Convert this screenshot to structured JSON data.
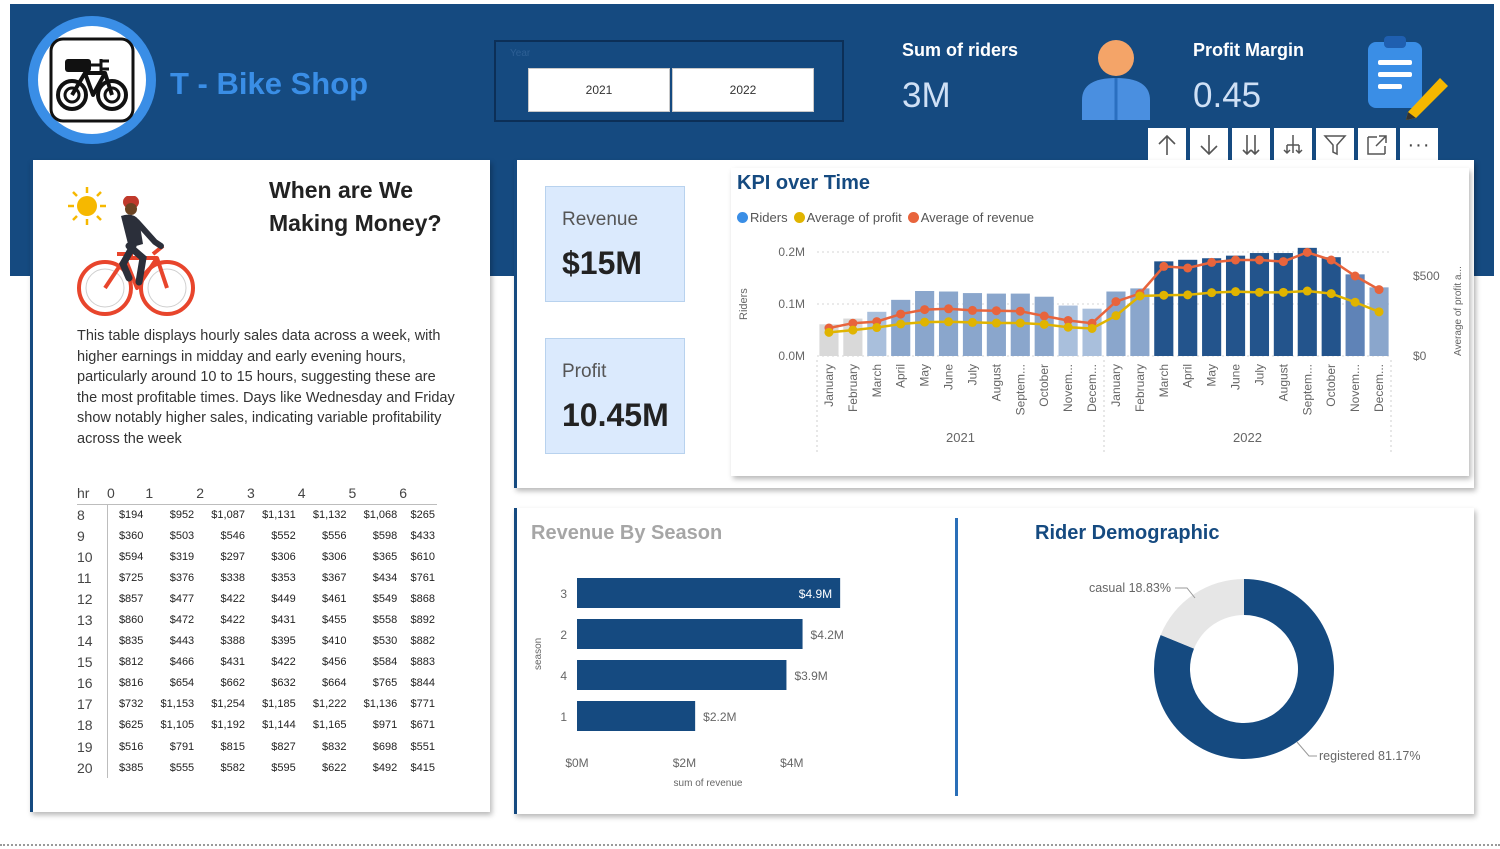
{
  "header": {
    "brand": "T - Bike Shop",
    "slicer": {
      "title": "Year",
      "options": [
        "2021",
        "2022"
      ]
    },
    "kpis": [
      {
        "title": "Sum of riders",
        "value": "3M"
      },
      {
        "title": "Profit Margin",
        "value": "0.45"
      }
    ]
  },
  "left_panel": {
    "title": "When are We Making Money?",
    "description": "This table displays hourly sales data across a week, with higher earnings in midday and early evening hours, particularly around 10 to 15 hours, suggesting these are the most profitable times. Days like Wednesday and Friday show notably higher sales, indicating variable profitability across the week",
    "table": {
      "header": [
        "hr",
        "0",
        "1",
        "2",
        "3",
        "4",
        "5",
        "6"
      ],
      "rows": [
        [
          "8",
          "$194",
          "$952",
          "$1,087",
          "$1,131",
          "$1,132",
          "$1,068",
          "$265"
        ],
        [
          "9",
          "$360",
          "$503",
          "$546",
          "$552",
          "$556",
          "$598",
          "$433"
        ],
        [
          "10",
          "$594",
          "$319",
          "$297",
          "$306",
          "$306",
          "$365",
          "$610"
        ],
        [
          "11",
          "$725",
          "$376",
          "$338",
          "$353",
          "$367",
          "$434",
          "$761"
        ],
        [
          "12",
          "$857",
          "$477",
          "$422",
          "$449",
          "$461",
          "$549",
          "$868"
        ],
        [
          "13",
          "$860",
          "$472",
          "$422",
          "$431",
          "$455",
          "$558",
          "$892"
        ],
        [
          "14",
          "$835",
          "$443",
          "$388",
          "$395",
          "$410",
          "$530",
          "$882"
        ],
        [
          "15",
          "$812",
          "$466",
          "$431",
          "$422",
          "$456",
          "$584",
          "$883"
        ],
        [
          "16",
          "$816",
          "$654",
          "$662",
          "$632",
          "$664",
          "$765",
          "$844"
        ],
        [
          "17",
          "$732",
          "$1,153",
          "$1,254",
          "$1,185",
          "$1,222",
          "$1,136",
          "$771"
        ],
        [
          "18",
          "$625",
          "$1,105",
          "$1,192",
          "$1,144",
          "$1,165",
          "$971",
          "$671"
        ],
        [
          "19",
          "$516",
          "$791",
          "$815",
          "$827",
          "$832",
          "$698",
          "$551"
        ],
        [
          "20",
          "$385",
          "$555",
          "$582",
          "$595",
          "$622",
          "$492",
          "$415"
        ]
      ]
    }
  },
  "metrics": [
    {
      "label": "Revenue",
      "value": "$15M"
    },
    {
      "label": "Profit",
      "value": "10.45M"
    }
  ],
  "toolbar": {
    "icons": [
      "arrow-up-icon",
      "arrow-down-icon",
      "double-arrow-down-icon",
      "expand-hierarchy-icon",
      "filter-icon",
      "focus-mode-icon",
      "more-options-icon"
    ],
    "more_label": "···"
  },
  "colors": {
    "header_bg": "#154a80",
    "accent": "#3a8ee6",
    "bar_dark": "#154a80",
    "profit_line": "#e0b400",
    "revenue_line": "#e8643c",
    "casual": "#e6e6e6"
  },
  "chart_data": [
    {
      "type": "bar",
      "title": "KPI over Time",
      "legend": [
        "Riders",
        "Average of profit",
        "Average of revenue"
      ],
      "legend_colors": [
        "#3a8ee6",
        "#e0b400",
        "#e8643c"
      ],
      "legend_position": "top-left",
      "ylabel": "Riders",
      "y2label": "Average of profit a...",
      "y_ticks": [
        "0.0M",
        "0.1M",
        "0.2M"
      ],
      "y2_ticks": [
        "$0",
        "$500"
      ],
      "ylim": [
        0,
        0.2
      ],
      "y2lim": [
        0,
        650
      ],
      "year_groups": [
        "2021",
        "2022"
      ],
      "categories": [
        "January",
        "February",
        "March",
        "April",
        "May",
        "June",
        "July",
        "August",
        "Septem...",
        "October",
        "Novem...",
        "Decem...",
        "January",
        "February",
        "March",
        "April",
        "May",
        "June",
        "July",
        "August",
        "Septem...",
        "October",
        "Novem...",
        "Decem..."
      ],
      "series": [
        {
          "name": "Riders",
          "type": "bar",
          "values": [
            0.061,
            0.072,
            0.085,
            0.108,
            0.125,
            0.124,
            0.121,
            0.12,
            0.12,
            0.114,
            0.097,
            0.091,
            0.124,
            0.13,
            0.182,
            0.185,
            0.188,
            0.193,
            0.198,
            0.198,
            0.208,
            0.19,
            0.157,
            0.132
          ]
        },
        {
          "name": "Average of profit",
          "type": "line",
          "values": [
            148,
            162,
            178,
            200,
            212,
            214,
            210,
            206,
            206,
            198,
            180,
            172,
            252,
            375,
            380,
            382,
            396,
            402,
            398,
            398,
            406,
            390,
            336,
            276
          ]
        },
        {
          "name": "Average of revenue",
          "type": "line",
          "values": [
            175,
            205,
            215,
            262,
            290,
            295,
            285,
            283,
            280,
            250,
            222,
            205,
            340,
            390,
            560,
            550,
            585,
            600,
            600,
            590,
            648,
            600,
            500,
            415
          ]
        }
      ]
    },
    {
      "type": "bar",
      "orientation": "horizontal",
      "title": "Revenue By Season",
      "categories": [
        "3",
        "2",
        "4",
        "1"
      ],
      "values": [
        4.9,
        4.2,
        3.9,
        2.2
      ],
      "data_labels": [
        "$4.9M",
        "$4.2M",
        "$3.9M",
        "$2.2M"
      ],
      "xlabel": "sum of revenue",
      "ylabel": "season",
      "x_ticks": [
        "$0M",
        "$2M",
        "$4M"
      ],
      "xlim": [
        0,
        5.4
      ]
    },
    {
      "type": "pie",
      "donut": true,
      "title": "Rider Demographic",
      "categories": [
        "casual",
        "registered"
      ],
      "values": [
        18.83,
        81.17
      ],
      "data_labels": [
        "casual 18.83%",
        "registered 81.17%"
      ],
      "colors": [
        "#e6e6e6",
        "#154a80"
      ]
    }
  ]
}
